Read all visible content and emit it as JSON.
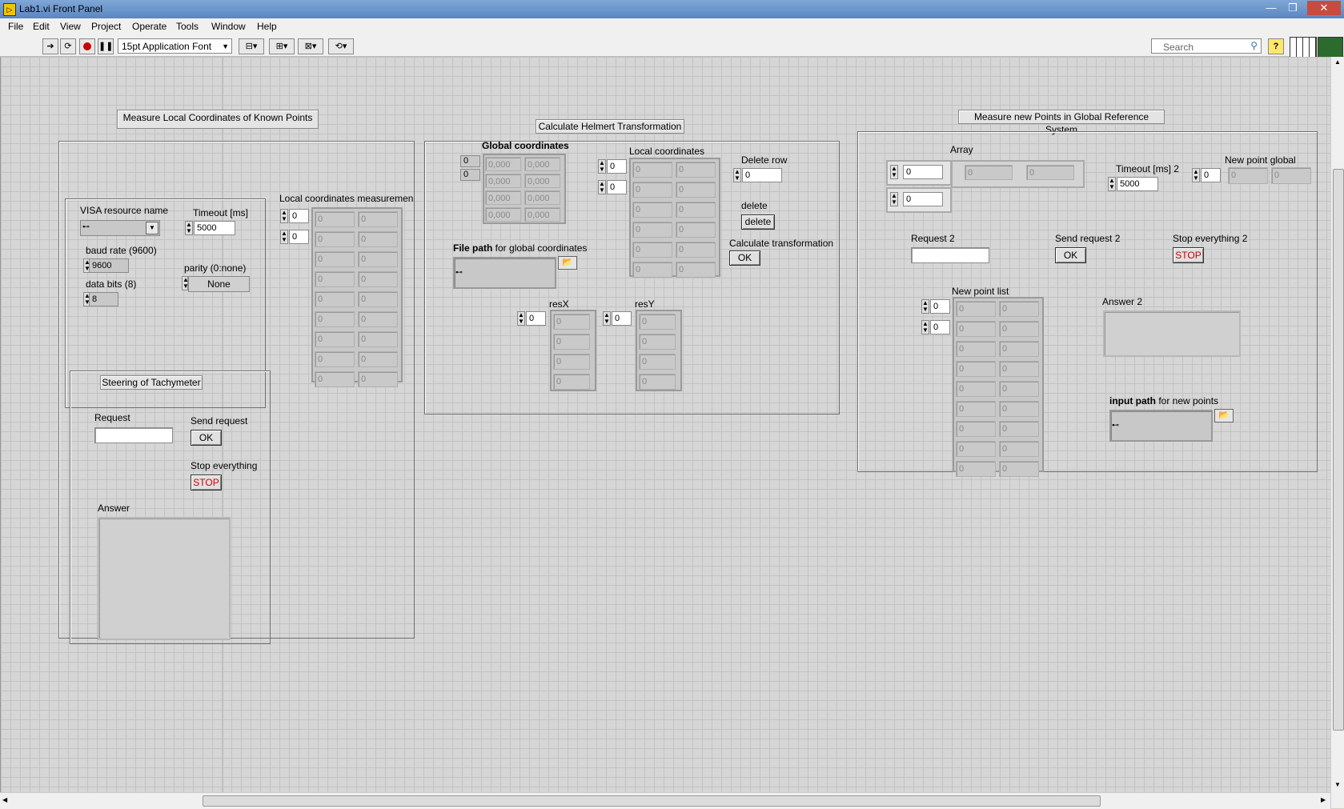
{
  "window": {
    "title": "Lab1.vi Front Panel",
    "minimize": "—",
    "restore": "❐",
    "close": "✕"
  },
  "menu": [
    "File",
    "Edit",
    "View",
    "Project",
    "Operate",
    "Tools",
    "Window",
    "Help"
  ],
  "toolbar": {
    "font": "15pt Application Font",
    "search_placeholder": "Search",
    "help": "?"
  },
  "decorations": {
    "measure_local": "Measure Local Coordinates of Known Points",
    "helmert": "Calculate Helmert Transformation",
    "measure_new": "Measure new Points in Global Reference System",
    "steering": "Steering of Tachymeter"
  },
  "left": {
    "visa_label": "VISA resource name",
    "timeout_label": "Timeout [ms]",
    "timeout_value": "5000",
    "baud_label": "baud rate (9600)",
    "baud_value": "9600",
    "parity_label": "parity (0:none)",
    "parity_value": "None",
    "databits_label": "data bits (8)",
    "databits_value": "8",
    "localmeas_label": "Local coordinates measuremen",
    "localmeas_idx": [
      "0",
      "0"
    ],
    "localmeas_cells": [
      [
        "0",
        "0"
      ],
      [
        "0",
        "0"
      ],
      [
        "0",
        "0"
      ],
      [
        "0",
        "0"
      ],
      [
        "0",
        "0"
      ],
      [
        "0",
        "0"
      ],
      [
        "0",
        "0"
      ],
      [
        "0",
        "0"
      ],
      [
        "0",
        "0"
      ]
    ],
    "request_label": "Request",
    "send_label": "Send request",
    "ok": "OK",
    "stop_label": "Stop everything",
    "stop": "STOP",
    "answer_label": "Answer"
  },
  "middle": {
    "global_label": "Global coordinates",
    "global_idx": [
      "0",
      "0"
    ],
    "global_cells": [
      [
        "0,000",
        "0,000"
      ],
      [
        "0,000",
        "0,000"
      ],
      [
        "0,000",
        "0,000"
      ],
      [
        "0,000",
        "0,000"
      ]
    ],
    "local_label": "Local coordinates",
    "local_idx": [
      "0",
      "0"
    ],
    "local_cells": [
      [
        "0",
        "0"
      ],
      [
        "0",
        "0"
      ],
      [
        "0",
        "0"
      ],
      [
        "0",
        "0"
      ],
      [
        "0",
        "0"
      ],
      [
        "0",
        "0"
      ]
    ],
    "deleterow_label": "Delete row",
    "deleterow_value": "0",
    "delete_label": "delete",
    "delete_button": "delete",
    "calc_label": "Calculate transformation",
    "ok": "OK",
    "filepath_bold": "File path",
    "filepath_rest": " for global coordinates",
    "resx_label": "resX",
    "resx_idx": "0",
    "resx_cells": [
      "0",
      "0",
      "0",
      "0"
    ],
    "resy_label": "resY",
    "resy_idx": "0",
    "resy_cells": [
      "0",
      "0",
      "0",
      "0"
    ]
  },
  "right": {
    "array_label": "Array",
    "array_idx1": "0",
    "array_idx2": "0",
    "array_cells": [
      "0",
      "0"
    ],
    "timeout2_label": "Timeout [ms] 2",
    "timeout2_value": "5000",
    "newglobal_label": "New point global",
    "newglobal_idx": "0",
    "newglobal_cells": [
      "0",
      "0"
    ],
    "request2_label": "Request 2",
    "send2_label": "Send request 2",
    "ok": "OK",
    "stop2_label": "Stop everything 2",
    "stop": "STOP",
    "newlist_label": "New point list",
    "newlist_idx": [
      "0",
      "0"
    ],
    "newlist_cells": [
      [
        "0",
        "0"
      ],
      [
        "0",
        "0"
      ],
      [
        "0",
        "0"
      ],
      [
        "0",
        "0"
      ],
      [
        "0",
        "0"
      ],
      [
        "0",
        "0"
      ],
      [
        "0",
        "0"
      ],
      [
        "0",
        "0"
      ],
      [
        "0",
        "0"
      ]
    ],
    "answer2_label": "Answer 2",
    "inputpath_bold": "input path",
    "inputpath_rest": " for new points"
  }
}
